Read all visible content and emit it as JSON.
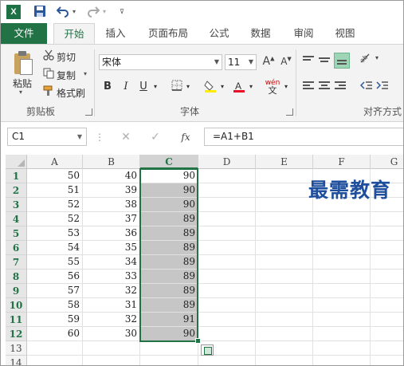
{
  "qat": {
    "app_icon": "X",
    "save_icon": "save-icon",
    "undo_icon": "undo-icon",
    "redo_icon": "redo-icon"
  },
  "tabs": [
    {
      "label": "文件"
    },
    {
      "label": "开始"
    },
    {
      "label": "插入"
    },
    {
      "label": "页面布局"
    },
    {
      "label": "公式"
    },
    {
      "label": "数据"
    },
    {
      "label": "审阅"
    },
    {
      "label": "视图"
    }
  ],
  "ribbon": {
    "clipboard": {
      "paste": "粘贴",
      "cut": "剪切",
      "copy": "复制",
      "painter": "格式刷",
      "group": "剪贴板"
    },
    "font": {
      "name": "宋体",
      "size": "11",
      "bold": "B",
      "italic": "I",
      "underline": "U",
      "grow": "A",
      "shrink": "A",
      "wen": "wén",
      "wen_char": "文",
      "group": "字体",
      "fill_color": "#ffeb00",
      "font_color": "#e81123"
    },
    "align": {
      "group": "对齐方式"
    }
  },
  "formula_bar": {
    "name_box": "C1",
    "cancel": "✕",
    "enter": "✓",
    "fx": "fx",
    "formula": "=A1+B1"
  },
  "columns": [
    "A",
    "B",
    "C",
    "D",
    "E",
    "F",
    "G"
  ],
  "rows": [
    {
      "n": "1",
      "a": "50",
      "b": "40",
      "c": "90"
    },
    {
      "n": "2",
      "a": "51",
      "b": "39",
      "c": "90"
    },
    {
      "n": "3",
      "a": "52",
      "b": "38",
      "c": "90"
    },
    {
      "n": "4",
      "a": "52",
      "b": "37",
      "c": "89"
    },
    {
      "n": "5",
      "a": "53",
      "b": "36",
      "c": "89"
    },
    {
      "n": "6",
      "a": "54",
      "b": "35",
      "c": "89"
    },
    {
      "n": "7",
      "a": "55",
      "b": "34",
      "c": "89"
    },
    {
      "n": "8",
      "a": "56",
      "b": "33",
      "c": "89"
    },
    {
      "n": "9",
      "a": "57",
      "b": "32",
      "c": "89"
    },
    {
      "n": "10",
      "a": "58",
      "b": "31",
      "c": "89"
    },
    {
      "n": "11",
      "a": "59",
      "b": "32",
      "c": "91"
    },
    {
      "n": "12",
      "a": "60",
      "b": "30",
      "c": "90"
    },
    {
      "n": "13",
      "a": "",
      "b": "",
      "c": ""
    },
    {
      "n": "14",
      "a": "",
      "b": "",
      "c": ""
    }
  ],
  "watermark": "最需教育",
  "accent": "#217346"
}
